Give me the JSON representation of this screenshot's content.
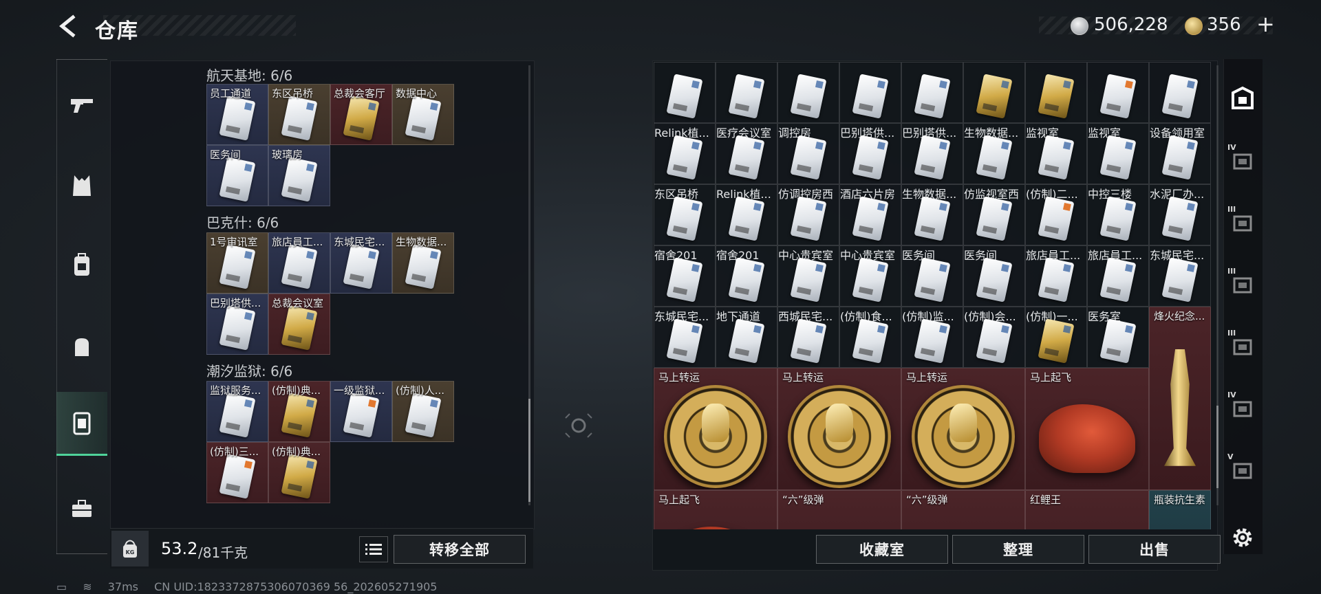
{
  "header": {
    "title": "仓库",
    "currency1_value": "506,228",
    "currency2_value": "356",
    "currency2_add": "+"
  },
  "left_sections": [
    {
      "title": "航天基地: 6/6",
      "items": [
        {
          "label": "员工通道",
          "bg": "blue",
          "card": "silver"
        },
        {
          "label": "东区吊桥",
          "bg": "brown",
          "card": "silver"
        },
        {
          "label": "总裁会客厅",
          "bg": "red",
          "card": "gold"
        },
        {
          "label": "数据中心",
          "bg": "brown",
          "card": "silver"
        },
        {
          "label": "医务间",
          "bg": "blue",
          "card": "silver"
        },
        {
          "label": "玻璃房",
          "bg": "blue",
          "card": "silver"
        }
      ]
    },
    {
      "title": "巴克什: 6/6",
      "items": [
        {
          "label": "1号审讯室",
          "bg": "brown",
          "card": "silver"
        },
        {
          "label": "旅店員工...",
          "bg": "blue",
          "card": "silver"
        },
        {
          "label": "东城民宅...",
          "bg": "blue",
          "card": "silver"
        },
        {
          "label": "生物数据...",
          "bg": "brown",
          "card": "silver"
        },
        {
          "label": "巴别塔供...",
          "bg": "blue",
          "card": "silver"
        },
        {
          "label": "总裁会议室",
          "bg": "red",
          "card": "gold"
        }
      ]
    },
    {
      "title": "潮汐监狱: 6/6",
      "items": [
        {
          "label": "监狱服务...",
          "bg": "blue",
          "card": "silver"
        },
        {
          "label": "(仿制)典...",
          "bg": "red",
          "card": "gold"
        },
        {
          "label": "一级监狱...",
          "bg": "blue",
          "card": "orange"
        },
        {
          "label": "(仿制)人...",
          "bg": "brown",
          "card": "silver"
        },
        {
          "label": "(仿制)三...",
          "bg": "red",
          "card": "orange"
        },
        {
          "label": "(仿制)典...",
          "bg": "red",
          "card": "gold"
        }
      ]
    }
  ],
  "weight": {
    "unit_icon": "KG",
    "current": "53.2",
    "max": "/81千克"
  },
  "buttons": {
    "transfer_all": "转移全部",
    "collection_room": "收藏室",
    "sort": "整理",
    "sell": "出售"
  },
  "right_rows": [
    [
      {
        "label": "",
        "bg": "red",
        "card": "silver"
      },
      {
        "label": "",
        "bg": "red",
        "card": "silver"
      },
      {
        "label": "",
        "bg": "red",
        "card": "silver"
      },
      {
        "label": "",
        "bg": "red",
        "card": "silver"
      },
      {
        "label": "",
        "bg": "red",
        "card": "silver"
      },
      {
        "label": "",
        "bg": "red",
        "card": "gold"
      },
      {
        "label": "",
        "bg": "red",
        "card": "gold"
      },
      {
        "label": "",
        "bg": "red",
        "card": "orange"
      },
      {
        "label": "",
        "bg": "red",
        "card": "silver"
      }
    ],
    [
      {
        "label": "Relink植...",
        "bg": "brown",
        "card": "silver"
      },
      {
        "label": "医疗会议室",
        "bg": "brown",
        "card": "silver"
      },
      {
        "label": "调控房",
        "bg": "brown",
        "card": "silver"
      },
      {
        "label": "巴别塔供...",
        "bg": "brown",
        "card": "silver"
      },
      {
        "label": "巴别塔供...",
        "bg": "brown",
        "card": "silver"
      },
      {
        "label": "生物数据...",
        "bg": "brown",
        "card": "silver"
      },
      {
        "label": "监视室",
        "bg": "brown",
        "card": "silver"
      },
      {
        "label": "监视室",
        "bg": "brown",
        "card": "silver"
      },
      {
        "label": "设备领用室",
        "bg": "brown",
        "card": "silver"
      }
    ],
    [
      {
        "label": "东区吊桥",
        "bg": "brown",
        "card": "silver"
      },
      {
        "label": "Relink植...",
        "bg": "brown",
        "card": "silver"
      },
      {
        "label": "仿调控房西",
        "bg": "brown",
        "card": "silver"
      },
      {
        "label": "酒店六片房",
        "bg": "brown",
        "card": "silver"
      },
      {
        "label": "生物数据...",
        "bg": "brown",
        "card": "silver"
      },
      {
        "label": "仿监视室西",
        "bg": "brown",
        "card": "silver"
      },
      {
        "label": "(仿制)二...",
        "bg": "brown",
        "card": "orange"
      },
      {
        "label": "中控三楼",
        "bg": "blue",
        "card": "silver"
      },
      {
        "label": "水泥厂办...",
        "bg": "blue",
        "card": "silver"
      }
    ],
    [
      {
        "label": "宿舍201",
        "bg": "blue",
        "card": "silver"
      },
      {
        "label": "宿舍201",
        "bg": "blue",
        "card": "silver"
      },
      {
        "label": "中心贵宾室",
        "bg": "blue",
        "card": "silver"
      },
      {
        "label": "中心贵宾室",
        "bg": "blue",
        "card": "silver"
      },
      {
        "label": "医务间",
        "bg": "blue",
        "card": "silver"
      },
      {
        "label": "医务间",
        "bg": "blue",
        "card": "silver"
      },
      {
        "label": "旅店員工...",
        "bg": "blue",
        "card": "silver"
      },
      {
        "label": "旅店員工...",
        "bg": "blue",
        "card": "silver"
      },
      {
        "label": "东城民宅...",
        "bg": "blue",
        "card": "silver"
      }
    ],
    [
      {
        "label": "东城民宅...",
        "bg": "blue",
        "card": "silver"
      },
      {
        "label": "地下通道",
        "bg": "blue",
        "card": "silver"
      },
      {
        "label": "西城民宅...",
        "bg": "blue",
        "card": "silver"
      },
      {
        "label": "(仿制)食...",
        "bg": "blue",
        "card": "silver"
      },
      {
        "label": "(仿制)监...",
        "bg": "blue",
        "card": "silver"
      },
      {
        "label": "(仿制)会...",
        "bg": "blue",
        "card": "silver"
      },
      {
        "label": "(仿制)一...",
        "bg": "blue",
        "card": "gold"
      },
      {
        "label": "医务室",
        "bg": "teal",
        "card": "silver"
      }
    ]
  ],
  "right_big": [
    {
      "label": "马上转运",
      "kind": "medal",
      "bg": "red"
    },
    {
      "label": "马上转运",
      "kind": "medal",
      "bg": "red"
    },
    {
      "label": "马上转运",
      "kind": "medal",
      "bg": "red"
    },
    {
      "label": "马上起飞",
      "kind": "horse",
      "bg": "red"
    },
    {
      "label": "烽火纪念...",
      "kind": "trophy",
      "bg": "red"
    },
    {
      "label": "马上起飞",
      "kind": "horse",
      "bg": "red"
    },
    {
      "label": "“六”级弹",
      "kind": "bullets",
      "bg": "red"
    },
    {
      "label": "“六”级弹",
      "kind": "bullets",
      "bg": "red"
    },
    {
      "label": "红鲤王",
      "kind": "fish",
      "bg": "red"
    },
    {
      "label": "瓶装抗生素",
      "kind": "bottle",
      "bg": "teal"
    }
  ],
  "right_nav_tiers": [
    "",
    "IV",
    "III",
    "III",
    "III",
    "IV",
    "V"
  ],
  "status": {
    "ping": "37ms",
    "uid": "CN UID:1823372875306070369 56_202605271905"
  }
}
